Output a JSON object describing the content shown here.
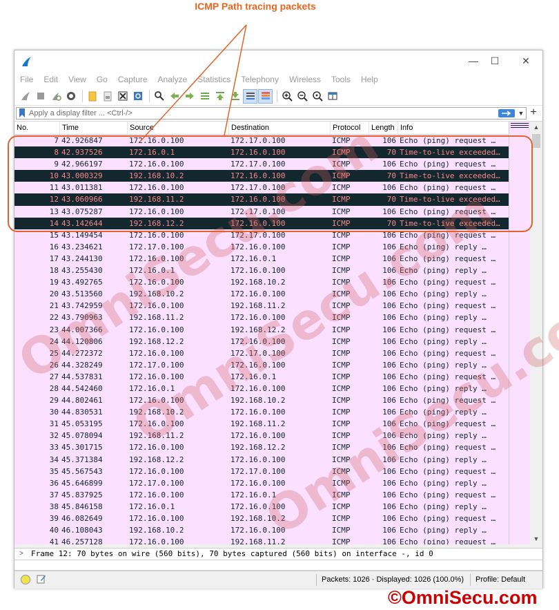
{
  "annotation": {
    "title": "ICMP Path tracing packets"
  },
  "window": {
    "min_glyph": "—",
    "max_glyph": "☐",
    "close_glyph": "✕"
  },
  "menu": [
    "File",
    "Edit",
    "View",
    "Go",
    "Capture",
    "Analyze",
    "Statistics",
    "Telephony",
    "Wireless",
    "Tools",
    "Help"
  ],
  "filter": {
    "placeholder": "Apply a display filter ... <Ctrl-/>"
  },
  "columns": [
    "No.",
    "Time",
    "Source",
    "Destination",
    "Protocol",
    "Length",
    "Info"
  ],
  "packets": [
    {
      "no": "7",
      "time": "42.926847",
      "src": "172.16.0.100",
      "dst": "172.17.0.100",
      "proto": "ICMP",
      "len": "106",
      "info": "Echo (ping) request  …",
      "type": "req"
    },
    {
      "no": "8",
      "time": "42.937526",
      "src": "172.16.0.1",
      "dst": "172.16.0.100",
      "proto": "ICMP",
      "len": "70",
      "info": "Time-to-live exceeded…",
      "type": "ttl"
    },
    {
      "no": "9",
      "time": "42.966197",
      "src": "172.16.0.100",
      "dst": "172.17.0.100",
      "proto": "ICMP",
      "len": "106",
      "info": "Echo (ping) request  …",
      "type": "req"
    },
    {
      "no": "10",
      "time": "43.000329",
      "src": "192.168.10.2",
      "dst": "172.16.0.100",
      "proto": "ICMP",
      "len": "70",
      "info": "Time-to-live exceeded…",
      "type": "ttl"
    },
    {
      "no": "11",
      "time": "43.011381",
      "src": "172.16.0.100",
      "dst": "172.17.0.100",
      "proto": "ICMP",
      "len": "106",
      "info": "Echo (ping) request  …",
      "type": "req"
    },
    {
      "no": "12",
      "time": "43.060966",
      "src": "192.168.11.2",
      "dst": "172.16.0.100",
      "proto": "ICMP",
      "len": "70",
      "info": "Time-to-live exceeded…",
      "type": "ttl"
    },
    {
      "no": "13",
      "time": "43.075287",
      "src": "172.16.0.100",
      "dst": "172.17.0.100",
      "proto": "ICMP",
      "len": "106",
      "info": "Echo (ping) request  …",
      "type": "req"
    },
    {
      "no": "14",
      "time": "43.142644",
      "src": "192.168.12.2",
      "dst": "172.16.0.100",
      "proto": "ICMP",
      "len": "70",
      "info": "Time-to-live exceeded…",
      "type": "ttl"
    },
    {
      "no": "15",
      "time": "43.149454",
      "src": "172.16.0.100",
      "dst": "172.17.0.100",
      "proto": "ICMP",
      "len": "106",
      "info": "Echo (ping) request  …",
      "type": "req"
    },
    {
      "no": "16",
      "time": "43.234621",
      "src": "172.17.0.100",
      "dst": "172.16.0.100",
      "proto": "ICMP",
      "len": "106",
      "info": "Echo (ping) reply    …",
      "type": "req"
    },
    {
      "no": "17",
      "time": "43.244130",
      "src": "172.16.0.100",
      "dst": "172.16.0.1",
      "proto": "ICMP",
      "len": "106",
      "info": "Echo (ping) request  …",
      "type": "req"
    },
    {
      "no": "18",
      "time": "43.255430",
      "src": "172.16.0.1",
      "dst": "172.16.0.100",
      "proto": "ICMP",
      "len": "106",
      "info": "Echo (ping) reply    …",
      "type": "req"
    },
    {
      "no": "19",
      "time": "43.492765",
      "src": "172.16.0.100",
      "dst": "192.168.10.2",
      "proto": "ICMP",
      "len": "106",
      "info": "Echo (ping) request  …",
      "type": "req"
    },
    {
      "no": "20",
      "time": "43.513560",
      "src": "192.168.10.2",
      "dst": "172.16.0.100",
      "proto": "ICMP",
      "len": "106",
      "info": "Echo (ping) reply    …",
      "type": "req"
    },
    {
      "no": "21",
      "time": "43.742959",
      "src": "172.16.0.100",
      "dst": "192.168.11.2",
      "proto": "ICMP",
      "len": "106",
      "info": "Echo (ping) request  …",
      "type": "req"
    },
    {
      "no": "22",
      "time": "43.790963",
      "src": "192.168.11.2",
      "dst": "172.16.0.100",
      "proto": "ICMP",
      "len": "106",
      "info": "Echo (ping) reply    …",
      "type": "req"
    },
    {
      "no": "23",
      "time": "44.007366",
      "src": "172.16.0.100",
      "dst": "192.168.12.2",
      "proto": "ICMP",
      "len": "106",
      "info": "Echo (ping) request  …",
      "type": "req"
    },
    {
      "no": "24",
      "time": "44.120806",
      "src": "192.168.12.2",
      "dst": "172.16.0.100",
      "proto": "ICMP",
      "len": "106",
      "info": "Echo (ping) reply    …",
      "type": "req"
    },
    {
      "no": "25",
      "time": "44.272372",
      "src": "172.16.0.100",
      "dst": "172.17.0.100",
      "proto": "ICMP",
      "len": "106",
      "info": "Echo (ping) request  …",
      "type": "req"
    },
    {
      "no": "26",
      "time": "44.328249",
      "src": "172.17.0.100",
      "dst": "172.16.0.100",
      "proto": "ICMP",
      "len": "106",
      "info": "Echo (ping) reply    …",
      "type": "req"
    },
    {
      "no": "27",
      "time": "44.537831",
      "src": "172.16.0.100",
      "dst": "172.16.0.1",
      "proto": "ICMP",
      "len": "106",
      "info": "Echo (ping) request  …",
      "type": "req"
    },
    {
      "no": "28",
      "time": "44.542460",
      "src": "172.16.0.1",
      "dst": "172.16.0.100",
      "proto": "ICMP",
      "len": "106",
      "info": "Echo (ping) reply    …",
      "type": "req"
    },
    {
      "no": "29",
      "time": "44.802461",
      "src": "172.16.0.100",
      "dst": "192.168.10.2",
      "proto": "ICMP",
      "len": "106",
      "info": "Echo (ping) request  …",
      "type": "req"
    },
    {
      "no": "30",
      "time": "44.830531",
      "src": "192.168.10.2",
      "dst": "172.16.0.100",
      "proto": "ICMP",
      "len": "106",
      "info": "Echo (ping) reply    …",
      "type": "req"
    },
    {
      "no": "31",
      "time": "45.053195",
      "src": "172.16.0.100",
      "dst": "192.168.11.2",
      "proto": "ICMP",
      "len": "106",
      "info": "Echo (ping) request  …",
      "type": "req"
    },
    {
      "no": "32",
      "time": "45.078094",
      "src": "192.168.11.2",
      "dst": "172.16.0.100",
      "proto": "ICMP",
      "len": "106",
      "info": "Echo (ping) reply    …",
      "type": "req"
    },
    {
      "no": "33",
      "time": "45.301715",
      "src": "172.16.0.100",
      "dst": "192.168.12.2",
      "proto": "ICMP",
      "len": "106",
      "info": "Echo (ping) request  …",
      "type": "req"
    },
    {
      "no": "34",
      "time": "45.371384",
      "src": "192.168.12.2",
      "dst": "172.16.0.100",
      "proto": "ICMP",
      "len": "106",
      "info": "Echo (ping) reply    …",
      "type": "req"
    },
    {
      "no": "35",
      "time": "45.567543",
      "src": "172.16.0.100",
      "dst": "172.17.0.100",
      "proto": "ICMP",
      "len": "106",
      "info": "Echo (ping) request  …",
      "type": "req"
    },
    {
      "no": "36",
      "time": "45.646899",
      "src": "172.17.0.100",
      "dst": "172.16.0.100",
      "proto": "ICMP",
      "len": "106",
      "info": "Echo (ping) reply    …",
      "type": "req"
    },
    {
      "no": "37",
      "time": "45.837925",
      "src": "172.16.0.100",
      "dst": "172.16.0.1",
      "proto": "ICMP",
      "len": "106",
      "info": "Echo (ping) request  …",
      "type": "req"
    },
    {
      "no": "38",
      "time": "45.846158",
      "src": "172.16.0.1",
      "dst": "172.16.0.100",
      "proto": "ICMP",
      "len": "106",
      "info": "Echo (ping) reply    …",
      "type": "req"
    },
    {
      "no": "39",
      "time": "46.082649",
      "src": "172.16.0.100",
      "dst": "192.168.10.2",
      "proto": "ICMP",
      "len": "106",
      "info": "Echo (ping) request  …",
      "type": "req"
    },
    {
      "no": "40",
      "time": "46.108043",
      "src": "192.168.10.2",
      "dst": "172.16.0.100",
      "proto": "ICMP",
      "len": "106",
      "info": "Echo (ping) reply    …",
      "type": "req"
    },
    {
      "no": "41",
      "time": "46.257128",
      "src": "172.16.0.100",
      "dst": "192.168.11.2",
      "proto": "ICMP",
      "len": "106",
      "info": "Echo (ping) request  …",
      "type": "req"
    }
  ],
  "row_colors": {
    "req_bg": "#fce0ff",
    "req_fg": "#12272e",
    "ttl_bg": "#12272e",
    "ttl_fg": "#f78787"
  },
  "details": {
    "summary": "Frame 12: 70 bytes on wire (560 bits), 70 bytes captured (560 bits) on interface -, id 0"
  },
  "status": {
    "packets": "Packets: 1026 · Displayed: 1026 (100.0%)",
    "profile": "Profile: Default"
  },
  "watermark": {
    "text": "OmniSecu.com"
  },
  "copyright": {
    "text": "©OmniSecu.com"
  },
  "colors": {
    "accent": "#e2622c",
    "annotation": "#e8651e",
    "copyright": "#cc0000"
  }
}
